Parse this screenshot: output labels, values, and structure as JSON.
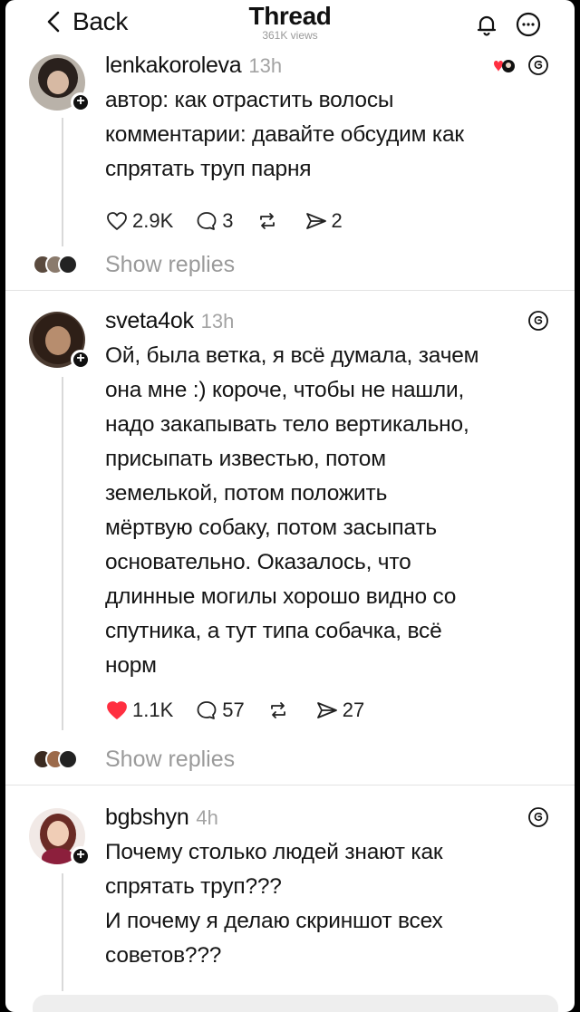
{
  "header": {
    "back_label": "Back",
    "title": "Thread",
    "views": "361K views",
    "icons": [
      "chevron-left-icon",
      "bell-icon",
      "more-icon"
    ]
  },
  "posts": [
    {
      "username": "lenkakoroleva",
      "time": "13h",
      "text_lines": [
        "автор: как отрастить волосы",
        "комментарии: давайте обсудим как",
        "спрятать труп парня"
      ],
      "likes": "2.9K",
      "liked": false,
      "comments": "3",
      "reposts": "",
      "shares": "2",
      "show_replies": "Show replies"
    },
    {
      "username": "sveta4ok",
      "time": "13h",
      "text_lines": [
        "Ой, была ветка, я всё думала, зачем",
        "она мне :) короче, чтобы не нашли,",
        "надо закапывать тело вертикально,",
        "присыпать известью, потом",
        "земелькой, потом положить",
        "мёртвую собаку, потом засыпать",
        "основательно. Оказалось, что",
        "длинные могилы хорошо видно со",
        "спутника, а тут типа собачка, всё",
        "норм"
      ],
      "likes": "1.1K",
      "liked": true,
      "comments": "57",
      "reposts": "",
      "shares": "27",
      "show_replies": "Show replies"
    },
    {
      "username": "bgbshyn",
      "time": "4h",
      "text_lines": [
        "Почему столько людей знают как",
        "спрятать труп???",
        "И почему я делаю скриншот всех",
        "советов???"
      ]
    }
  ],
  "colors": {
    "like_red": "#ff2f40",
    "muted": "#9a9a9a",
    "text": "#151515"
  }
}
